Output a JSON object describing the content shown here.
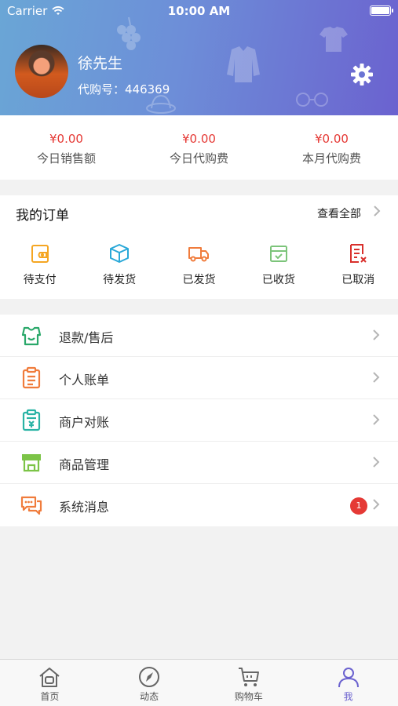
{
  "status_bar": {
    "carrier": "Carrier",
    "time": "10:00 AM"
  },
  "profile": {
    "name": "徐先生",
    "agent_id": "代购号：446369"
  },
  "stats": [
    {
      "value": "¥0.00",
      "label": "今日销售额"
    },
    {
      "value": "¥0.00",
      "label": "今日代购费"
    },
    {
      "value": "¥0.00",
      "label": "本月代购费"
    }
  ],
  "orders": {
    "title": "我的订单",
    "view_all": "查看全部",
    "items": [
      {
        "label": "待支付",
        "icon": "wallet-icon",
        "color": "#f5a623"
      },
      {
        "label": "待发货",
        "icon": "box-icon",
        "color": "#29a8d8"
      },
      {
        "label": "已发货",
        "icon": "truck-icon",
        "color": "#f07c3c"
      },
      {
        "label": "已收货",
        "icon": "received-box-icon",
        "color": "#7cc47a"
      },
      {
        "label": "已取消",
        "icon": "cancelled-doc-icon",
        "color": "#d9302c"
      }
    ]
  },
  "menu": [
    {
      "label": "退款/售后",
      "icon": "refund-icon",
      "color": "#2aa86a"
    },
    {
      "label": "个人账单",
      "icon": "clipboard-icon",
      "color": "#f07c3c"
    },
    {
      "label": "商户对账",
      "icon": "receipt-icon",
      "color": "#29b3a5"
    },
    {
      "label": "商品管理",
      "icon": "store-icon",
      "color": "#7cc447"
    },
    {
      "label": "系统消息",
      "icon": "message-icon",
      "color": "#f07c3c",
      "badge": "1"
    }
  ],
  "tabbar": [
    {
      "label": "首页",
      "icon": "home-icon"
    },
    {
      "label": "动态",
      "icon": "compass-icon"
    },
    {
      "label": "购物车",
      "icon": "cart-icon"
    },
    {
      "label": "我",
      "icon": "person-icon",
      "active": true
    }
  ],
  "colors": {
    "header_start": "#6aa6d6",
    "header_end": "#6b62cf",
    "price": "#e53935",
    "active_tab": "#6b62cf",
    "badge": "#e53935"
  }
}
